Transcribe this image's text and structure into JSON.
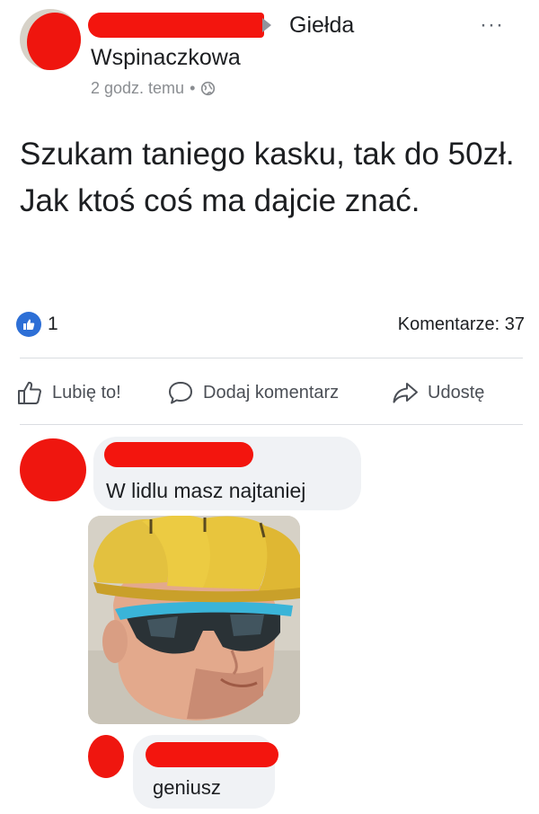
{
  "post": {
    "group_name_line1": "Giełda",
    "group_name_line2": "Wspinaczkowa",
    "time": "2 godz. temu",
    "separator": "•",
    "privacy_icon": "globe-icon",
    "more_label": "···",
    "text": "Szukam taniego kasku, tak do 50zł. Jak ktoś coś ma dajcie znać."
  },
  "stats": {
    "reaction_icon": "thumbs-up-icon",
    "likes": "1",
    "comments": "Komentarze: 37"
  },
  "actions": {
    "like": "Lubię to!",
    "comment": "Dodaj komentarz",
    "share": "Udostę"
  },
  "comments": [
    {
      "text": "W lidlu masz najtaniej",
      "has_photo": true
    },
    {
      "text": "geniusz"
    }
  ],
  "colors": {
    "redaction": "#f3150e",
    "like_blue": "#2d6fd6",
    "bubble": "#f0f2f5"
  }
}
